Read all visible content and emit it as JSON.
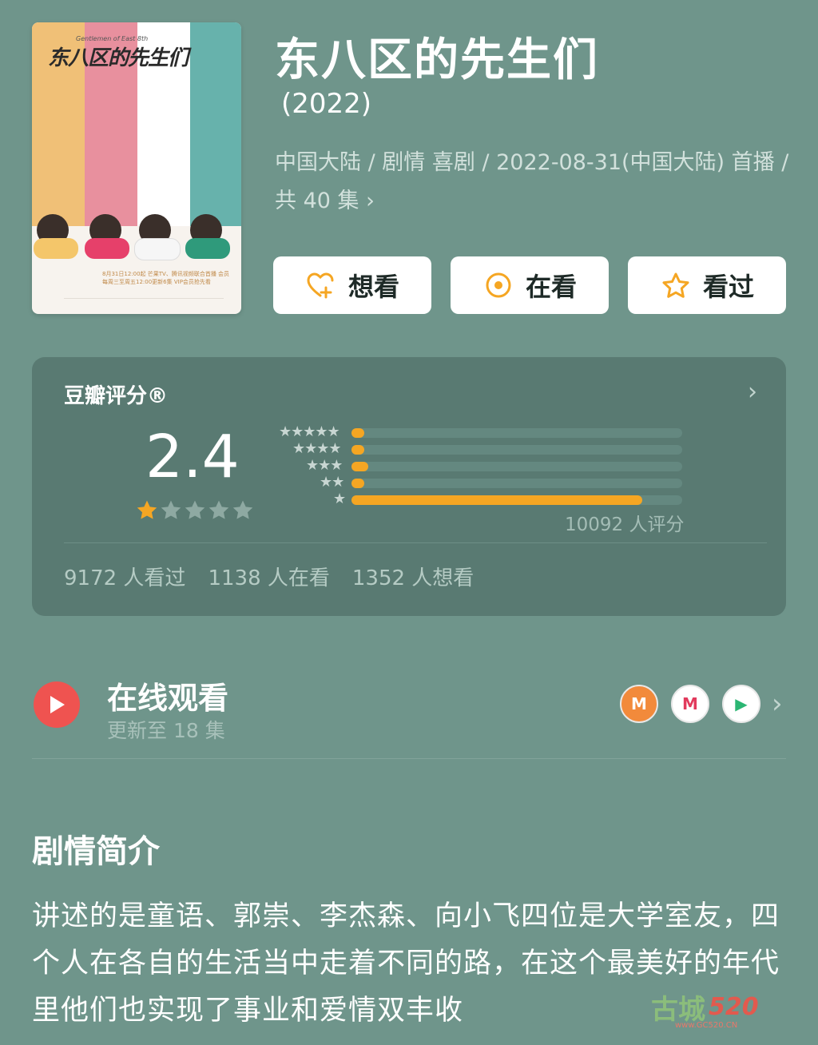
{
  "movie": {
    "title": "东八区的先生们",
    "year": "(2022)",
    "meta_line": "中国大陆 / 剧情 喜剧 / 2022-08-31(中国大陆) 首播 / 共 40 集 ›",
    "poster_title": "东八区的先生们",
    "poster_title_en": "Gentlemen of East 8th",
    "poster_release_text": "8月31日12:00起 芒果TV、腾讯视频联合首播 会员每周三至周五12:00更新6集 VIP会员抢先看",
    "poster_stripe_colors": [
      "#f0c077",
      "#e8909e",
      "#ffffff",
      "#67b2ac"
    ]
  },
  "actions": {
    "want": "想看",
    "watching": "在看",
    "watched": "看过",
    "accent_color": "#f5a623"
  },
  "rating": {
    "label": "豆瓣评分®",
    "score": "2.4",
    "stars_filled": 1,
    "stars_total": 5,
    "distribution": [
      {
        "stars": "★★★★★",
        "fraction": 0.03
      },
      {
        "stars": "★★★★",
        "fraction": 0.03
      },
      {
        "stars": "★★★",
        "fraction": 0.05
      },
      {
        "stars": "★★",
        "fraction": 0.03
      },
      {
        "stars": "★",
        "fraction": 0.88
      }
    ],
    "count_text": "10092 人评分",
    "stats": {
      "watched": "9172 人看过",
      "watching": "1138 人在看",
      "want": "1352 人想看"
    }
  },
  "online": {
    "title": "在线观看",
    "subtitle": "更新至 18 集",
    "platforms": [
      {
        "icon": "mango-tv-icon",
        "glyph": "M",
        "bg": "#f28a3b",
        "color": "#ffffff"
      },
      {
        "icon": "migu-icon",
        "glyph": "M",
        "bg": "#ffffff",
        "color": "#e23a5c"
      },
      {
        "icon": "tencent-video-icon",
        "glyph": "▶",
        "bg": "#ffffff",
        "color": "#2bb673"
      }
    ]
  },
  "synopsis": {
    "title": "剧情简介",
    "text": "讲述的是童语、郭崇、李杰森、向小飞四位是大学室友，四个人在各自的生活当中走着不同的路，在这个最美好的年代里他们也实现了事业和爱情双丰收"
  },
  "watermark": {
    "cn": "古城",
    "num": "520",
    "small": "www.GC520.CN"
  }
}
